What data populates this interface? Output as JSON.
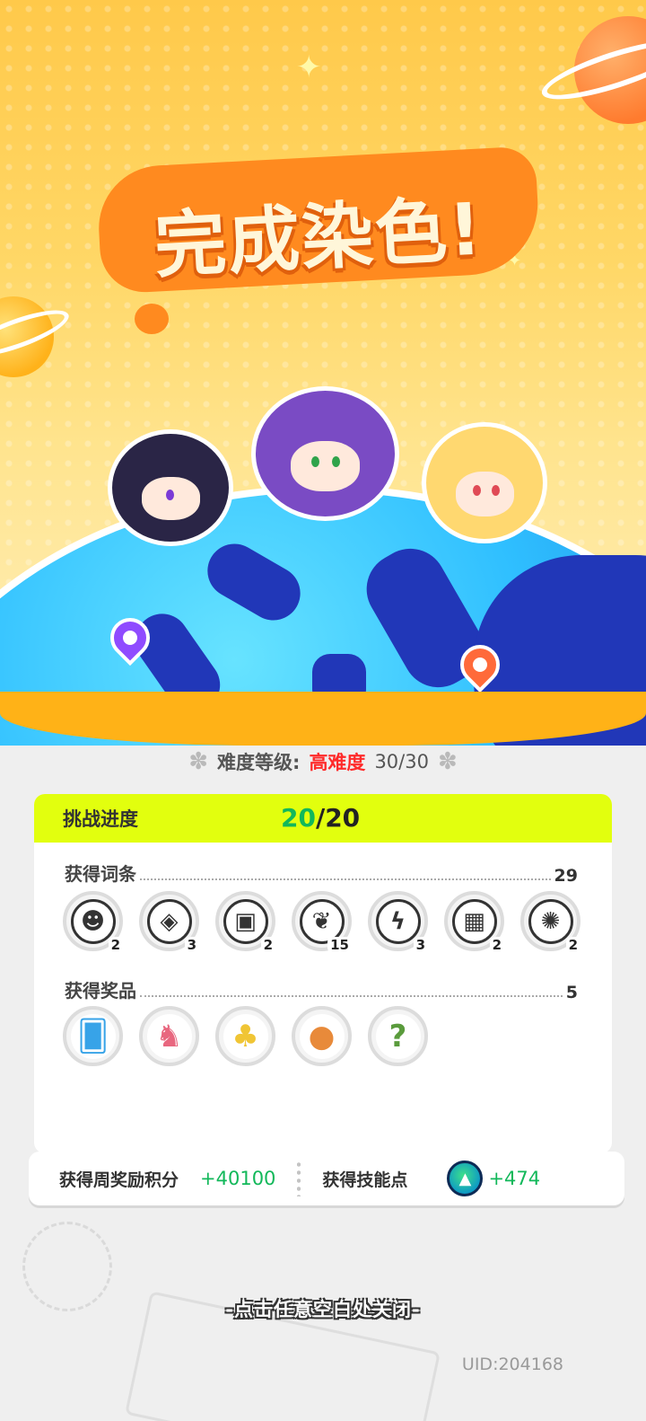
{
  "title": "完成染色!",
  "difficulty": {
    "label": "难度等级:",
    "level": "高难度",
    "count": "30/30"
  },
  "progress": {
    "label": "挑战进度",
    "current": "20",
    "separator": "/",
    "total": "20"
  },
  "entries": {
    "title": "获得词条",
    "count": "29",
    "items": [
      {
        "icon": "grin-face-icon",
        "glyph": "☻",
        "count": "2"
      },
      {
        "icon": "magic-card-icon",
        "glyph": "◈",
        "count": "3"
      },
      {
        "icon": "wanted-poster-icon",
        "glyph": "▣",
        "count": "2"
      },
      {
        "icon": "sprout-icon",
        "glyph": "❦",
        "count": "15"
      },
      {
        "icon": "lightning-icon",
        "glyph": "ϟ",
        "count": "3"
      },
      {
        "icon": "film-reel-icon",
        "glyph": "▦",
        "count": "2"
      },
      {
        "icon": "splat-icon",
        "glyph": "✺",
        "count": "2"
      }
    ]
  },
  "prizes": {
    "title": "获得奖品",
    "count": "5",
    "items": [
      {
        "icon": "trading-card-icon",
        "glyph": "🂠",
        "color": "#37a3e8"
      },
      {
        "icon": "pony-icon",
        "glyph": "♞",
        "color": "#e8677f"
      },
      {
        "icon": "mushrooms-icon",
        "glyph": "♣",
        "color": "#f0c535"
      },
      {
        "icon": "coin-icon",
        "glyph": "●",
        "color": "#e88a3a"
      },
      {
        "icon": "mystery-mushroom-icon",
        "glyph": "?",
        "color": "#5a9b3c"
      }
    ]
  },
  "rewards": {
    "weekly_label": "获得周奖励积分",
    "weekly_value": "+40100",
    "skill_label": "获得技能点",
    "skill_value": "+474"
  },
  "footer": {
    "close_hint": "-点击任意空白处关闭-",
    "uid": "UID:204168"
  },
  "colors": {
    "accent_green": "#12b85a",
    "progress_bar": "#e2ff0e",
    "difficulty_red": "#ff2a2a",
    "title_orange": "#ff8a1f"
  }
}
